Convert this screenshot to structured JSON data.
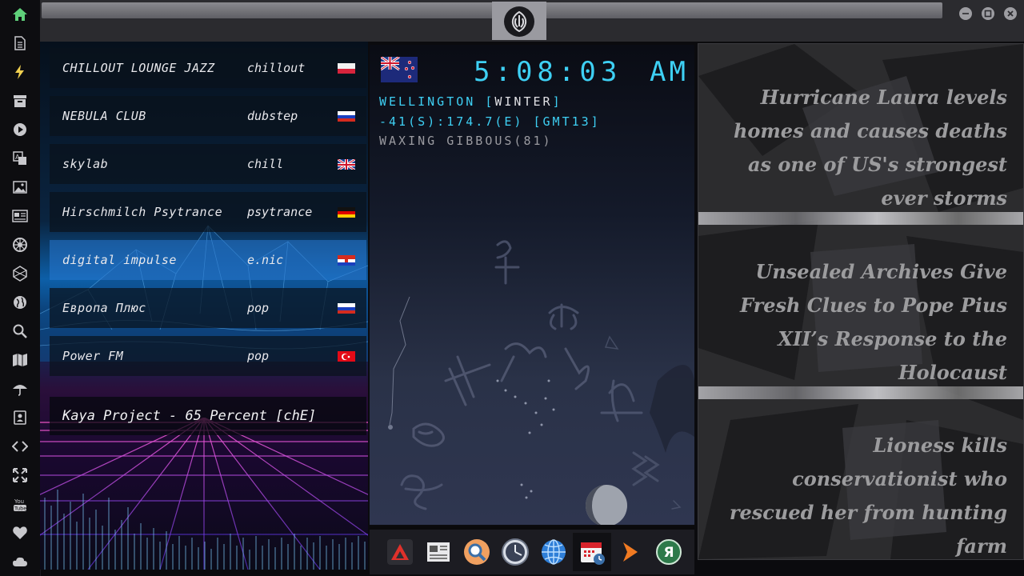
{
  "rail": {
    "icons": [
      "home-icon",
      "document-icon",
      "bolt-icon",
      "archive-icon",
      "play-icon",
      "translate-icon",
      "image-icon",
      "news-icon",
      "empire-icon",
      "hexagon-icon",
      "globe-icon",
      "search-icon",
      "map-icon",
      "umbrella-icon",
      "contact-icon",
      "code-icon",
      "expand-icon",
      "youtube-icon",
      "heart-icon",
      "cloud-icon"
    ],
    "youtube_label": "You Tube"
  },
  "radio": {
    "stations": [
      {
        "name": "CHILLOUT LOUNGE JAZZ",
        "genre": "chillout",
        "flag": "pl"
      },
      {
        "name": "NEBULA CLUB",
        "genre": "dubstep",
        "flag": "ru"
      },
      {
        "name": "skylab",
        "genre": "chill",
        "flag": "gb"
      },
      {
        "name": "Hirschmilch Psytrance",
        "genre": "psytrance",
        "flag": "de"
      },
      {
        "name": "digital impulse",
        "genre": "e.nic",
        "flag": "hr"
      },
      {
        "name": "Европа Плюс",
        "genre": "pop",
        "flag": "ru"
      },
      {
        "name": "Power FM",
        "genre": "pop",
        "flag": "tr"
      }
    ],
    "active_index": 4,
    "now_playing": "Kaya Project - 65 Percent [chE]"
  },
  "clock": {
    "time": "5:08:03",
    "ampm": "AM",
    "city_line_prefix": "WELLINGTON [",
    "city_season": "WINTER",
    "city_line_suffix": "]",
    "coords": "-41(S):174.7(E) [GMT13]",
    "moon": "WAXING GIBBOUS(81)",
    "accent": "#3ed0f4"
  },
  "dock": {
    "apps": [
      "triangle-app-icon",
      "newspaper-app-icon",
      "search-app-icon",
      "clock-app-icon",
      "globe-app-icon",
      "calendar-app-icon",
      "arrow-app-icon",
      "yandex-app-icon"
    ],
    "yandex_label": "Я",
    "selected_index": 5
  },
  "news": {
    "headlines": [
      "Hurricane Laura levels homes and causes deaths as one of US's strongest ever storms",
      "Unsealed Archives Give Fresh Clues to Pope Pius XII’s Response to the Holocaust",
      "Lioness kills conservationist who rescued her from hunting farm"
    ]
  }
}
